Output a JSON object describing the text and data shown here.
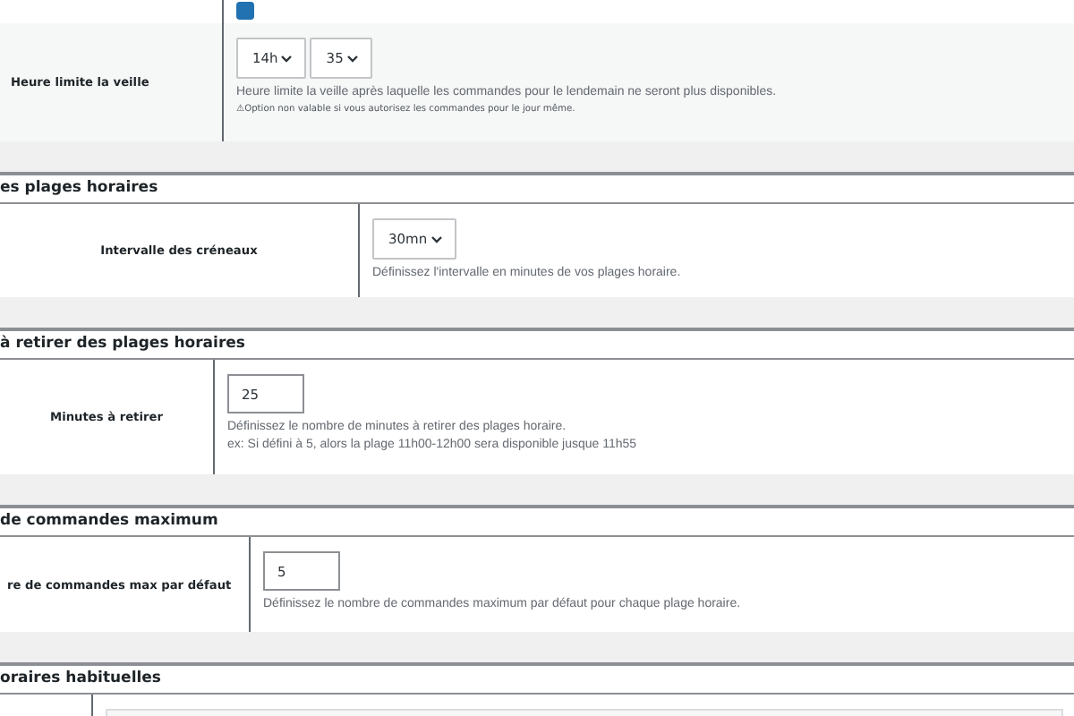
{
  "sections": [
    {
      "rows": [
        {
          "controls": [
            {
              "kind": "checkbox",
              "checked": true
            }
          ],
          "help": []
        },
        {
          "label": "Heure limite la veille",
          "controls": [
            {
              "kind": "select",
              "value": "14h"
            },
            {
              "kind": "select",
              "value": "35"
            }
          ],
          "help": [
            "Heure limite la veille après laquelle les commandes pour le lendemain ne seront plus disponibles."
          ],
          "note": "⚠Option non valable si vous autorisez les commandes pour le jour même."
        }
      ]
    },
    {
      "title": "es plages horaires",
      "rows": [
        {
          "label": "Intervalle des créneaux",
          "controls": [
            {
              "kind": "select",
              "value": "30mn"
            }
          ],
          "help": [
            "Définissez l'intervalle en minutes de vos plages horaire."
          ]
        }
      ]
    },
    {
      "title": "à retirer des plages horaires",
      "rows": [
        {
          "label": "Minutes à retirer",
          "controls": [
            {
              "kind": "input",
              "value": "25"
            }
          ],
          "help": [
            "Définissez le nombre de minutes à retirer des plages horaire.",
            "ex: Si défini à 5, alors la plage 11h00-12h00 sera disponible jusque 11h55"
          ]
        }
      ]
    },
    {
      "title": "de commandes maximum",
      "rows": [
        {
          "label": "re de commandes max par défaut",
          "controls": [
            {
              "kind": "input",
              "value": "5"
            }
          ],
          "help": [
            "Définissez le nombre de commandes maximum par défaut pour chaque plage horaire."
          ]
        }
      ]
    },
    {
      "title": "oraires habituelles",
      "rows": [
        {
          "controls": [
            {
              "kind": "panel"
            }
          ],
          "help": []
        }
      ]
    }
  ]
}
